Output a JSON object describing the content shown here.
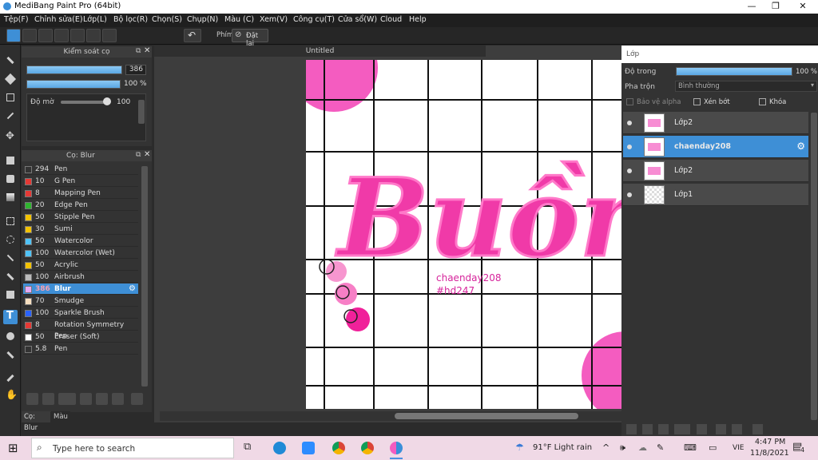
{
  "window": {
    "title": "MediBang Paint Pro (64bit)"
  },
  "menu": [
    "Tệp(F)",
    "Chỉnh sửa(E)",
    "Lớp(L)",
    "Bộ lọc(R)",
    "Chọn(S)",
    "Chụp(N)",
    "Màu (C)",
    "Xem(V)",
    "Công cụ(T)",
    "Cửa sổ(W)",
    "Cloud",
    "Help"
  ],
  "toolbar": {
    "keys_label": "Phím",
    "reset_label": "Đặt lại"
  },
  "brush_control": {
    "title": "Kiểm soát cọ",
    "size_value": "386",
    "opacity_value": "100 %",
    "blur_label": "Độ mờ",
    "blur_value": "100"
  },
  "brush_panel": {
    "title": "Cọ: Blur",
    "brushes": [
      {
        "size": "294",
        "name": "Pen",
        "color": "#333333"
      },
      {
        "size": "10",
        "name": "G Pen",
        "color": "#e53935"
      },
      {
        "size": "8",
        "name": "Mapping Pen",
        "color": "#e53935"
      },
      {
        "size": "20",
        "name": "Edge Pen",
        "color": "#2fb52f"
      },
      {
        "size": "50",
        "name": "Stipple Pen",
        "color": "#f2c200"
      },
      {
        "size": "30",
        "name": "Sumi",
        "color": "#f2c200"
      },
      {
        "size": "50",
        "name": "Watercolor",
        "color": "#4fc3f7"
      },
      {
        "size": "100",
        "name": "Watercolor (Wet)",
        "color": "#4fc3f7"
      },
      {
        "size": "50",
        "name": "Acrylic",
        "color": "#f2c200"
      },
      {
        "size": "100",
        "name": "Airbrush",
        "color": "#bbbbbb"
      },
      {
        "size": "386",
        "name": "Blur",
        "color": "#e7a9f5",
        "selected": true
      },
      {
        "size": "70",
        "name": "Smudge",
        "color": "#f7dfc0"
      },
      {
        "size": "100",
        "name": "Sparkle Brush",
        "color": "#2962ff"
      },
      {
        "size": "8",
        "name": "Rotation Symmetry Pen",
        "color": "#e53935"
      },
      {
        "size": "50",
        "name": "Eraser (Soft)",
        "color": "#ffffff"
      },
      {
        "size": "5.8",
        "name": "Pen",
        "color": "#333333"
      }
    ],
    "tabs": [
      "Cọ: Blur",
      "Màu"
    ]
  },
  "canvas": {
    "title": "Untitled",
    "text_line1": "chaenday208",
    "text_line2": "#hd247",
    "art_word": "Buồn"
  },
  "layer_panel": {
    "title": "Lớp",
    "opacity_label": "Độ trong",
    "opacity_value": "100 %",
    "blend_label": "Pha trộn",
    "blend_value": "Bình thường",
    "protect_alpha": "Bảo vệ alpha",
    "clipping": "Xén bớt",
    "lock": "Khóa",
    "layers": [
      {
        "name": "Lớp2",
        "selected": false
      },
      {
        "name": "chaenday208",
        "selected": true
      },
      {
        "name": "Lớp2",
        "selected": false
      },
      {
        "name": "Lớp1",
        "selected": false
      }
    ]
  },
  "taskbar": {
    "search_placeholder": "Type here to search",
    "weather": "91°F  Light rain",
    "language": "VIE",
    "time": "4:47 PM",
    "date": "11/8/2021",
    "notifications": "4"
  },
  "colors": {
    "accent": "#3e8fd6",
    "ink_pink": "#f03aa8"
  }
}
